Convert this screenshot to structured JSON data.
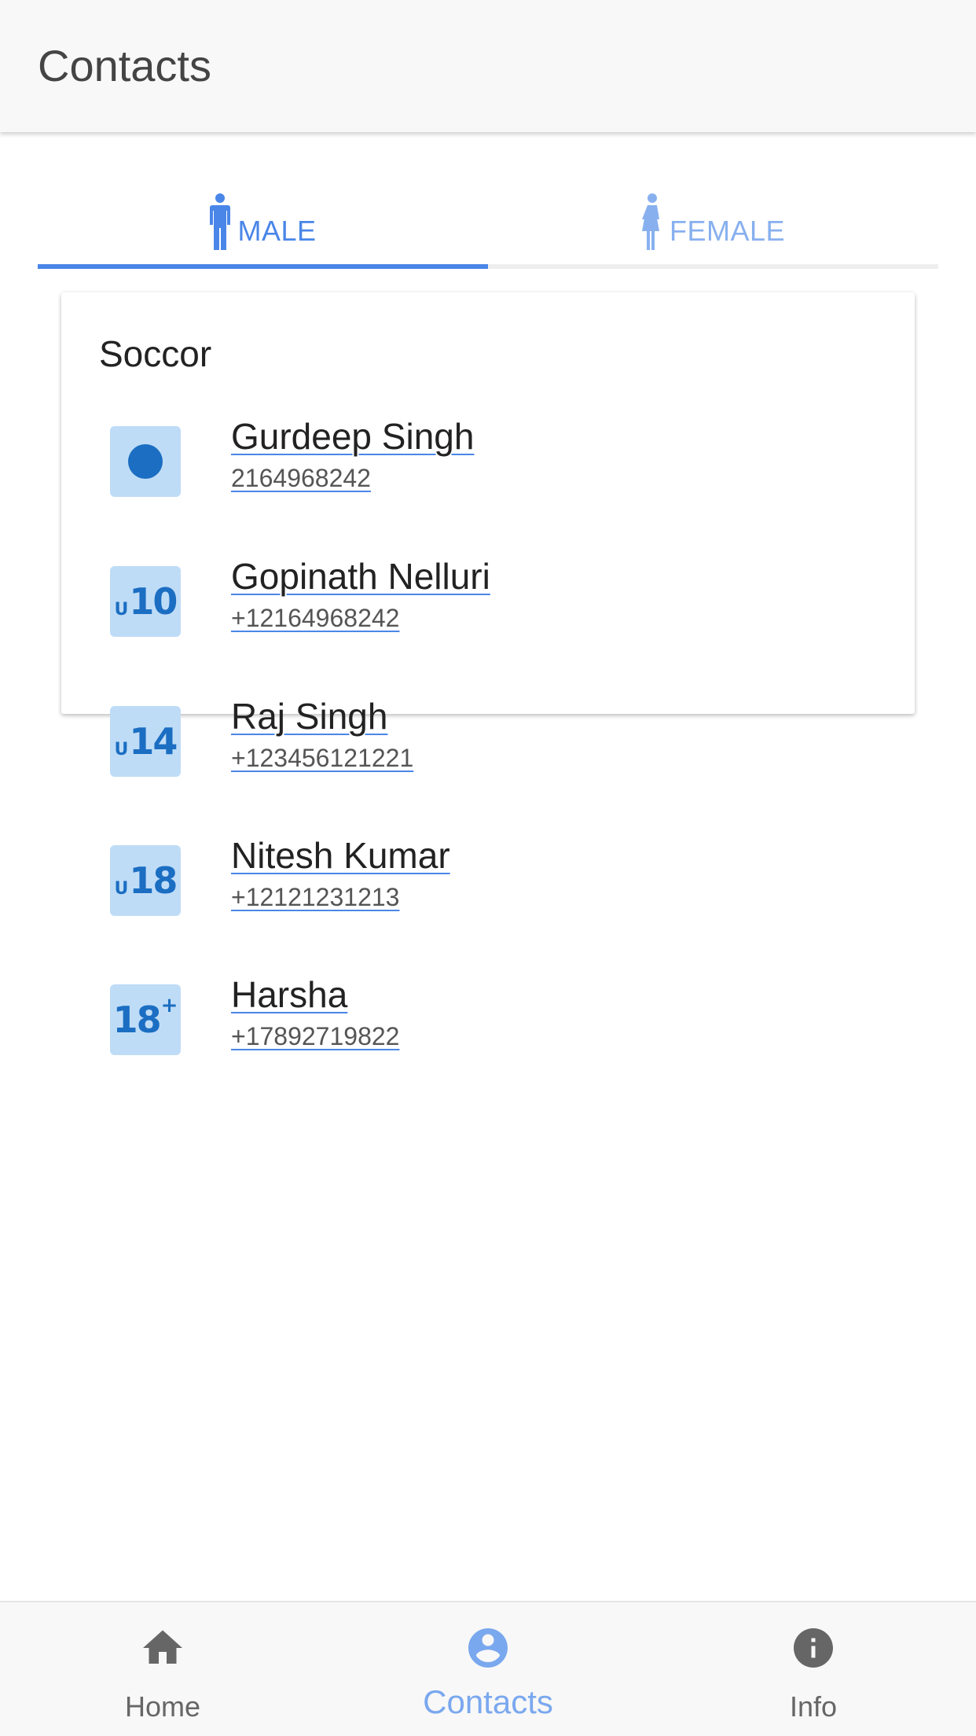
{
  "header": {
    "title": "Contacts"
  },
  "tabs": [
    {
      "label": "MALE",
      "icon": "male-icon",
      "selected": true
    },
    {
      "label": "FEMALE",
      "icon": "female-icon",
      "selected": false
    }
  ],
  "card": {
    "title": "Soccor",
    "contacts": [
      {
        "name": "Gurdeep Singh",
        "phone": "2164968242",
        "badge": "",
        "badge_icon": "dot-icon"
      },
      {
        "name": "Gopinath Nelluri",
        "phone": "+12164968242",
        "badge": "10",
        "badge_prefix": "U",
        "badge_icon": "u10-badge-icon"
      },
      {
        "name": "Raj Singh",
        "phone": "+123456121221",
        "badge": "14",
        "badge_prefix": "U",
        "badge_icon": "u14-badge-icon"
      },
      {
        "name": "Nitesh Kumar",
        "phone": "+12121231213",
        "badge": "18",
        "badge_prefix": "U",
        "badge_icon": "u18-badge-icon"
      },
      {
        "name": "Harsha",
        "phone": "+17892719822",
        "badge": "18",
        "badge_suffix": "+",
        "badge_icon": "18-plus-badge-icon"
      }
    ]
  },
  "bottom_nav": [
    {
      "label": "Home",
      "icon": "home-icon",
      "selected": false
    },
    {
      "label": "Contacts",
      "icon": "account-circle-icon",
      "selected": true
    },
    {
      "label": "Info",
      "icon": "info-icon",
      "selected": false
    }
  ],
  "colors": {
    "accent": "#4a86e8",
    "accent_light": "#88b0ef",
    "badge_bg": "#bfdcf7",
    "badge_fg": "#1b6ec2",
    "header_bg": "#f8f8f8"
  }
}
